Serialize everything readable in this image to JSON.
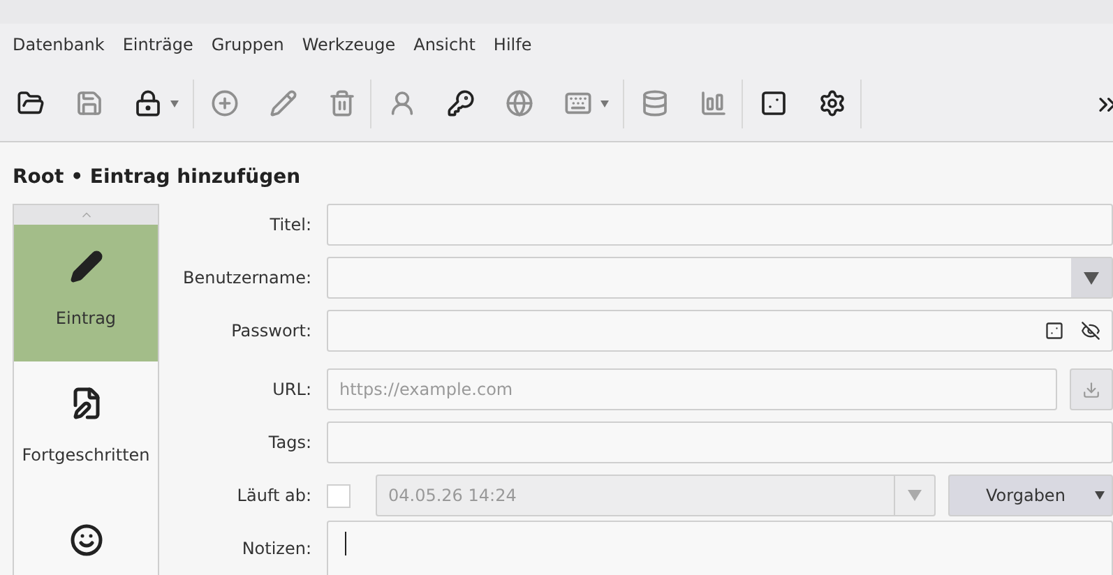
{
  "menu": [
    "Datenbank",
    "Einträge",
    "Gruppen",
    "Werkzeuge",
    "Ansicht",
    "Hilfe"
  ],
  "toolbar": {
    "groups": [
      [
        {
          "kind": "open",
          "disabled": false
        },
        {
          "kind": "save",
          "disabled": true
        },
        {
          "kind": "lock",
          "disabled": false,
          "dropdown": true
        }
      ],
      [
        {
          "kind": "add",
          "disabled": true
        },
        {
          "kind": "edit",
          "disabled": true
        },
        {
          "kind": "delete",
          "disabled": true
        }
      ],
      [
        {
          "kind": "user",
          "disabled": true
        },
        {
          "kind": "key",
          "disabled": false
        },
        {
          "kind": "globe",
          "disabled": true
        },
        {
          "kind": "keyboard",
          "disabled": true,
          "dropdown": true
        }
      ],
      [
        {
          "kind": "database",
          "disabled": true
        },
        {
          "kind": "report",
          "disabled": true
        }
      ],
      [
        {
          "kind": "dice",
          "disabled": false
        },
        {
          "kind": "settings",
          "disabled": false
        }
      ]
    ]
  },
  "header": {
    "title": "Root • Eintrag hinzufügen"
  },
  "sidebar": {
    "items": [
      {
        "kind": "pencil",
        "label": "Eintrag",
        "selected": true
      },
      {
        "kind": "document",
        "label": "Fortgeschritten",
        "selected": false
      },
      {
        "kind": "smiley",
        "selected": false
      }
    ]
  },
  "form": {
    "rows": [
      {
        "kind": "text",
        "label": "Titel:"
      },
      {
        "kind": "combo",
        "label": "Benutzername:"
      },
      {
        "kind": "password",
        "label": "Passwort:"
      },
      {
        "kind": "url",
        "label": "URL:",
        "placeholder": "https://example.com"
      },
      {
        "kind": "text",
        "label": "Tags:"
      },
      {
        "kind": "expiry",
        "label": "Läuft ab:",
        "checked": false,
        "value": "04.05.26 14:24",
        "button": "Vorgaben"
      },
      {
        "kind": "notes",
        "label": "Notizen:"
      }
    ]
  }
}
